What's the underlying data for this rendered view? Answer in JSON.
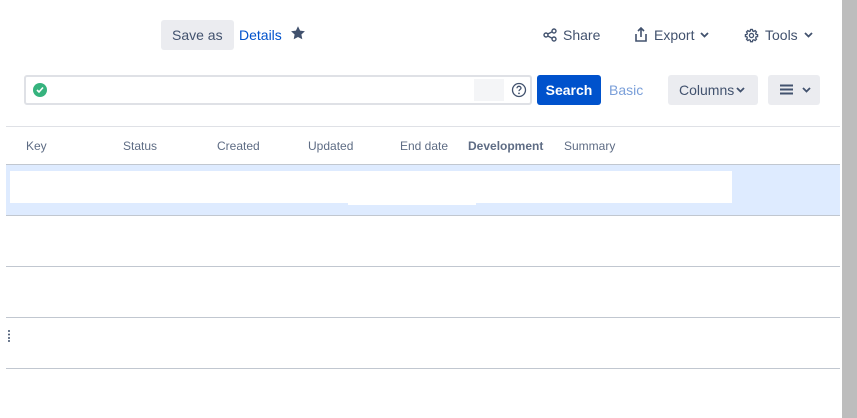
{
  "toolbar": {
    "save_as_label": "Save as",
    "details_label": "Details",
    "share_label": "Share",
    "export_label": "Export",
    "tools_label": "Tools"
  },
  "search": {
    "value": "",
    "search_label": "Search",
    "basic_label": "Basic",
    "columns_label": "Columns"
  },
  "table": {
    "columns": [
      "Key",
      "Status",
      "Created",
      "Updated",
      "End date",
      "Development",
      "Summary"
    ]
  },
  "colors": {
    "primary": "#0052cc",
    "selected_row": "#deebff",
    "valid_check": "#36b37e"
  },
  "icons": [
    "star-icon",
    "share-icon",
    "export-icon",
    "gear-icon",
    "chevron-down-icon",
    "check-icon",
    "help-icon",
    "hamburger-icon"
  ]
}
